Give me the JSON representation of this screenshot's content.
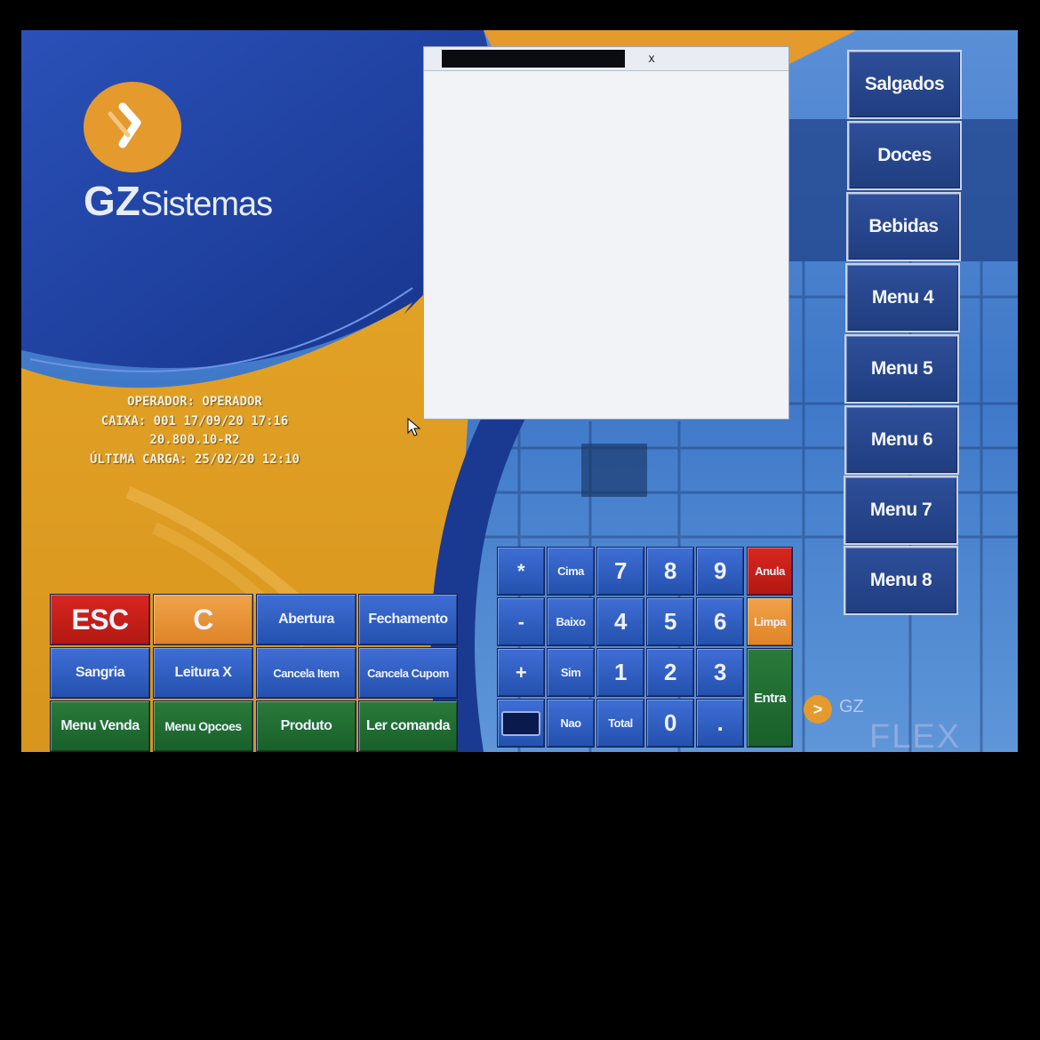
{
  "brand": {
    "name_bold": "GZ",
    "name_rest": "Sistemas",
    "logo_icon": "chevron-right-icon",
    "accent": "#e49a2c",
    "primary": "#1d3f9c"
  },
  "info": {
    "operator": "OPERADOR: OPERADOR",
    "caixa": "CAIXA: 001  17/09/20  17:16",
    "version": "20.800.10-R2",
    "last_load": "ÚLTIMA CARGA: 25/02/20 12:10"
  },
  "dialog": {
    "close_label": "x"
  },
  "menu": [
    "Salgados",
    "Doces",
    "Bebidas",
    "Menu 4",
    "Menu 5",
    "Menu 6",
    "Menu 7",
    "Menu 8"
  ],
  "actions": {
    "esc": "ESC",
    "clear": "C",
    "abertura": "Abertura",
    "fechamento": "Fechamento",
    "sangria": "Sangria",
    "leitura_x": "Leitura X",
    "cancela_item": "Cancela Item",
    "cancela_cupom": "Cancela Cupom",
    "menu_venda": "Menu Venda",
    "menu_opcoes": "Menu Opcoes",
    "produto": "Produto",
    "ler_comanda": "Ler comanda"
  },
  "keypad": {
    "star": "*",
    "cima": "Cima",
    "minus": "-",
    "baixo": "Baixo",
    "plus": "+",
    "sim": "Sim",
    "nao": "Nao",
    "total": "Total",
    "n7": "7",
    "n8": "8",
    "n9": "9",
    "n4": "4",
    "n5": "5",
    "n6": "6",
    "n1": "1",
    "n2": "2",
    "n3": "3",
    "n0": "0",
    "dot": ".",
    "anula": "Anula",
    "limpa": "Limpa",
    "entra": "Entra",
    "keyboard_icon": "keyboard-icon"
  },
  "product_logo": {
    "gz": "GZ",
    "word": "FLEX"
  }
}
